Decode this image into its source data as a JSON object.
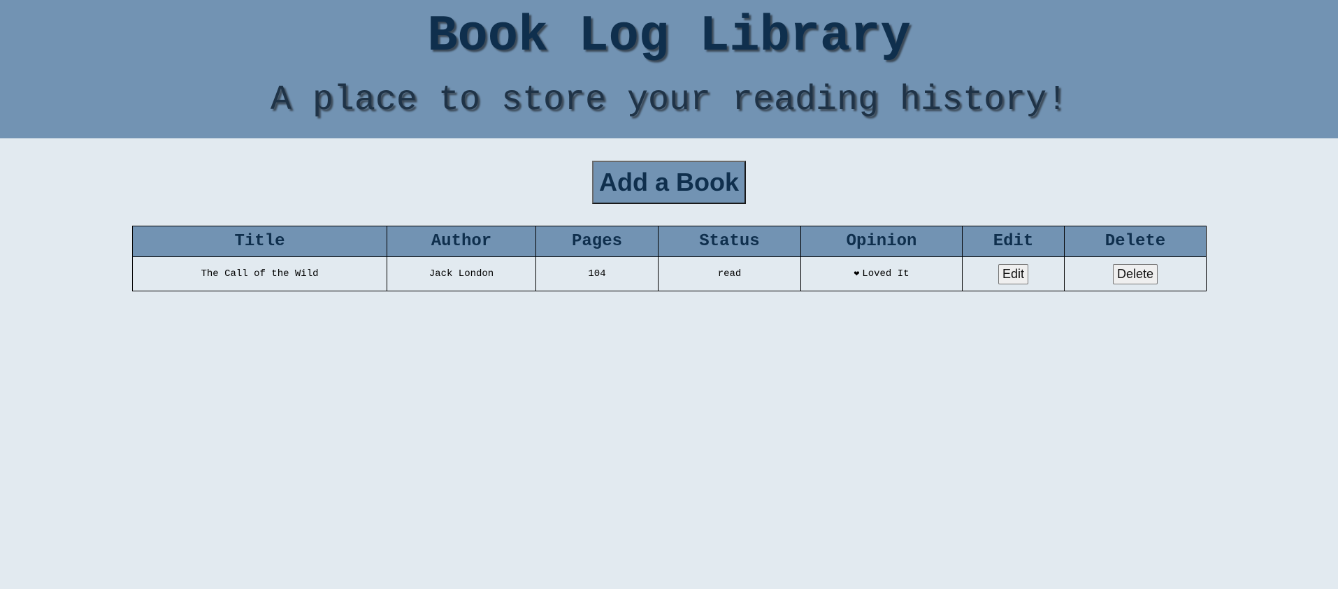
{
  "header": {
    "title": "Book Log Library",
    "subtitle": "A place to store your reading history!"
  },
  "actions": {
    "add_book_label": "Add a Book"
  },
  "table": {
    "columns": [
      "Title",
      "Author",
      "Pages",
      "Status",
      "Opinion",
      "Edit",
      "Delete"
    ],
    "rows": [
      {
        "title": "The Call of the Wild",
        "author": "Jack London",
        "pages": "104",
        "status": "read",
        "opinion_icon": "heart-icon",
        "opinion": "Loved It",
        "edit_label": "Edit",
        "delete_label": "Delete"
      }
    ]
  },
  "colors": {
    "header_bg": "#7293b3",
    "page_bg": "#e2eaf0",
    "title_text": "#0f2f4d"
  }
}
